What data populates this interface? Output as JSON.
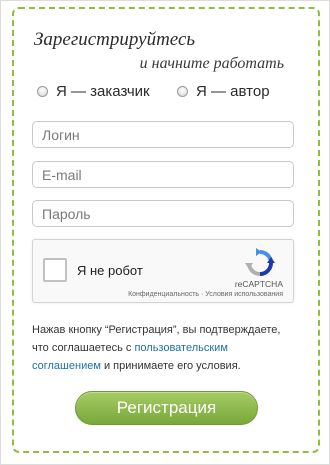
{
  "form": {
    "title_line1": "Зарегистрируйтесь",
    "title_line2": "и начните работать",
    "roles": [
      {
        "label": "Я — заказчик",
        "selected": false
      },
      {
        "label": "Я — автор",
        "selected": false
      }
    ],
    "fields": {
      "login": {
        "placeholder": "Логин",
        "value": ""
      },
      "email": {
        "placeholder": "E-mail",
        "value": ""
      },
      "password": {
        "placeholder": "Пароль",
        "value": ""
      }
    },
    "consent": {
      "part1": "Нажав кнопку “Регистрация”, вы подтверждаете, что соглашаетесь с ",
      "link": "пользовательским соглашением",
      "part2": " и принимаете его условия."
    },
    "submit_label": "Регистрация"
  },
  "captcha": {
    "label": "Я не робот",
    "brand": "reCAPTCHA",
    "terms": "Конфиденциальность · Условия использования",
    "checked": false
  },
  "colors": {
    "border_accent": "#8dbf3e",
    "button_top": "#a5cc64",
    "button_bottom": "#79a83a",
    "link": "#1f6fa8"
  },
  "icons": [
    "recaptcha-logo-icon"
  ]
}
